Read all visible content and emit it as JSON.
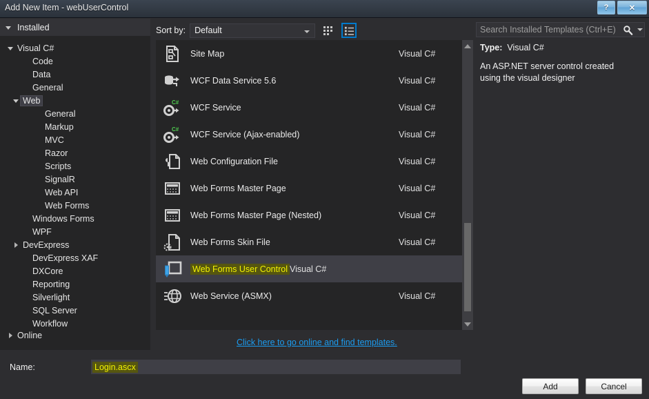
{
  "window": {
    "title": "Add New Item - webUserControl",
    "help_button": "?",
    "close_button": "✕"
  },
  "left_panel": {
    "header": "Installed",
    "tree": [
      {
        "label": "Visual C#",
        "level": 0,
        "expander": "down",
        "selected": false
      },
      {
        "label": "Code",
        "level": 1,
        "expander": "none",
        "selected": false
      },
      {
        "label": "Data",
        "level": 1,
        "expander": "none",
        "selected": false
      },
      {
        "label": "General",
        "level": 1,
        "expander": "none",
        "selected": false
      },
      {
        "label": "Web",
        "level": 1,
        "expander": "down",
        "selected": true
      },
      {
        "label": "General",
        "level": 2,
        "expander": "none",
        "selected": false
      },
      {
        "label": "Markup",
        "level": 2,
        "expander": "none",
        "selected": false
      },
      {
        "label": "MVC",
        "level": 2,
        "expander": "none",
        "selected": false
      },
      {
        "label": "Razor",
        "level": 2,
        "expander": "none",
        "selected": false
      },
      {
        "label": "Scripts",
        "level": 2,
        "expander": "none",
        "selected": false
      },
      {
        "label": "SignalR",
        "level": 2,
        "expander": "none",
        "selected": false
      },
      {
        "label": "Web API",
        "level": 2,
        "expander": "none",
        "selected": false
      },
      {
        "label": "Web Forms",
        "level": 2,
        "expander": "none",
        "selected": false
      },
      {
        "label": "Windows Forms",
        "level": 1,
        "expander": "none",
        "selected": false
      },
      {
        "label": "WPF",
        "level": 1,
        "expander": "none",
        "selected": false
      },
      {
        "label": "DevExpress",
        "level": 1,
        "expander": "right",
        "selected": false
      },
      {
        "label": "DevExpress XAF",
        "level": 1,
        "expander": "none",
        "selected": false
      },
      {
        "label": "DXCore",
        "level": 1,
        "expander": "none",
        "selected": false
      },
      {
        "label": "Reporting",
        "level": 1,
        "expander": "none",
        "selected": false
      },
      {
        "label": "Silverlight",
        "level": 1,
        "expander": "none",
        "selected": false
      },
      {
        "label": "SQL Server",
        "level": 1,
        "expander": "none",
        "selected": false
      },
      {
        "label": "Workflow",
        "level": 1,
        "expander": "none",
        "selected": false
      }
    ],
    "online": {
      "label": "Online",
      "expander": "right"
    }
  },
  "toolbar": {
    "sort_by_label": "Sort by:",
    "sort_by_value": "Default",
    "tiles_view_name": "tiles-view-icon",
    "list_view_name": "list-view-icon",
    "active_view": "list"
  },
  "templates": {
    "items": [
      {
        "name": "Site Map",
        "language": "Visual C#",
        "icon": "sitemap-file-icon",
        "selected": false
      },
      {
        "name": "WCF Data Service 5.6",
        "language": "Visual C#",
        "icon": "wcf-data-service-icon",
        "selected": false
      },
      {
        "name": "WCF Service",
        "language": "Visual C#",
        "icon": "wcf-service-icon",
        "selected": false
      },
      {
        "name": "WCF Service (Ajax-enabled)",
        "language": "Visual C#",
        "icon": "wcf-service-icon",
        "selected": false
      },
      {
        "name": "Web Configuration File",
        "language": "Visual C#",
        "icon": "web-config-file-icon",
        "selected": false
      },
      {
        "name": "Web Forms Master Page",
        "language": "Visual C#",
        "icon": "master-page-icon",
        "selected": false
      },
      {
        "name": "Web Forms Master Page (Nested)",
        "language": "Visual C#",
        "icon": "master-page-icon",
        "selected": false
      },
      {
        "name": "Web Forms Skin File",
        "language": "Visual C#",
        "icon": "skin-file-icon",
        "selected": false
      },
      {
        "name": "Web Forms User Control",
        "language": "Visual C#",
        "icon": "user-control-icon",
        "selected": true
      },
      {
        "name": "Web Service (ASMX)",
        "language": "Visual C#",
        "icon": "web-service-icon",
        "selected": false
      }
    ],
    "online_link": "Click here to go online and find templates."
  },
  "search": {
    "placeholder": "Search Installed Templates (Ctrl+E)",
    "value": ""
  },
  "preview": {
    "type_label": "Type:",
    "type_value": "Visual C#",
    "description": "An ASP.NET server control created using the visual designer"
  },
  "footer": {
    "name_label": "Name:",
    "name_value": "Login.ascx",
    "add_button": "Add",
    "cancel_button": "Cancel"
  },
  "colors": {
    "dialog_bg": "#2d2d30",
    "panel_bg": "#252526",
    "selection_bg": "#3f3f46",
    "highlight_bg": "#565610",
    "highlight_text": "#f2f200",
    "accent": "#007acc",
    "link": "#1b9cf0"
  }
}
